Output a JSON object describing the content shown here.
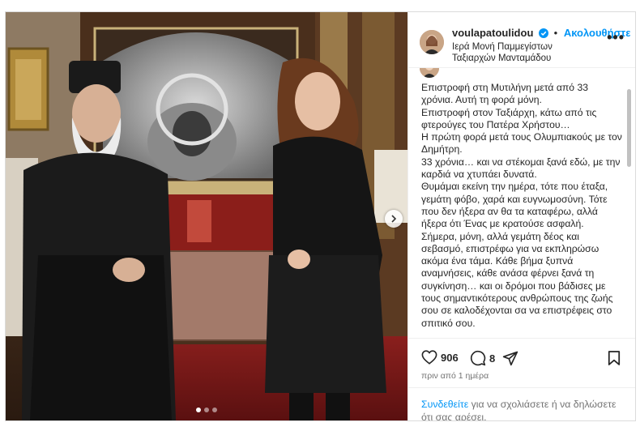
{
  "post": {
    "username": "voulapatoulidou",
    "follow_label": "Ακολουθήστε",
    "location": "Ιερά Μονή Παμμεγίστων Ταξιαρχών Μανταμάδου",
    "more_label": "•••",
    "caption": [
      "Επιστροφή στη Μυτιλήνη μετά από 33 χρόνια. Αυτή τη φορά μόνη.",
      "Επιστροφή στον Ταξιάρχη, κάτω από τις φτερούγες του Πατέρα Χρήστου…",
      "Η πρώτη φορά μετά τους Ολυμπιακούς με τον Δημήτρη.",
      "33 χρόνια… και να στέκομαι ξανά εδώ, με την καρδιά να χτυπάει δυνατά.",
      "Θυμάμαι εκείνη την ημέρα, τότε που έταξα, γεμάτη φόβο, χαρά και ευγνωμοσύνη. Τότε που δεν ήξερα αν θα τα καταφέρω, αλλά ήξερα ότι Ένας με κρατούσε ασφαλή.",
      "Σήμερα, μόνη, αλλά γεμάτη δέος και σεβασμό, επιστρέφω για να εκπληρώσω ακόμα ένα τάμα. Κάθε βήμα ξυπνά αναμνήσεις, κάθε ανάσα φέρνει ξανά τη συγκίνηση… και οι δρόμοι που βάδισες με τους σημαντικότερους ανθρώπους της ζωής σου σε καλοδέχονται σα να επιστρέφεις στο σπιτικό σου."
    ],
    "likes": "906",
    "comments": "8",
    "timestamp": "πριν από 1 ημέρα",
    "login_link": "Συνδεθείτε",
    "login_rest": " για να σχολιάσετε ή να δηλώσετε ότι σας αρέσει.",
    "carousel": {
      "current": 1,
      "total": 3
    }
  },
  "colors": {
    "accent": "#0095f6",
    "text": "#262626",
    "muted": "#737373",
    "border": "#dbdbdb"
  },
  "icons": [
    "verified-badge-icon",
    "more-options-icon",
    "heart-icon",
    "comment-icon",
    "share-icon",
    "bookmark-icon",
    "carousel-next-icon"
  ]
}
